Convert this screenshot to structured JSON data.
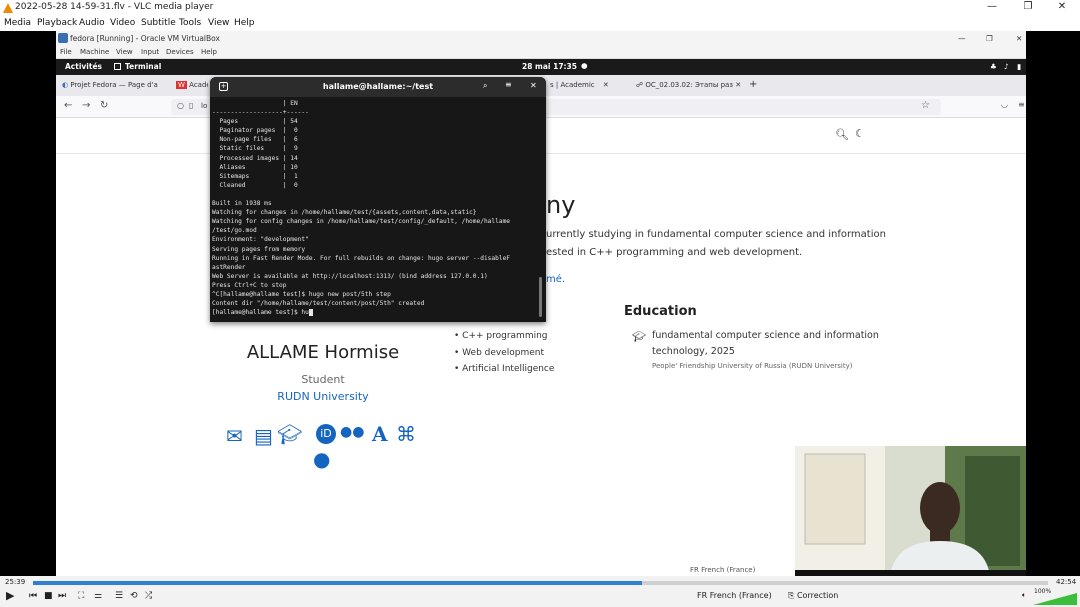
{
  "vlc": {
    "title": "2022-05-28 14-59-31.flv - VLC media player",
    "menu": [
      "Media",
      "Playback",
      "Audio",
      "Video",
      "Subtitle",
      "Tools",
      "View",
      "Help"
    ],
    "time_elapsed": "25:39",
    "time_total": "42:54",
    "progress": 0.6,
    "volume": "100%"
  },
  "vbox": {
    "title": "fedora [Running] - Oracle VM VirtualBox",
    "menu": [
      "File",
      "Machine",
      "View",
      "Input",
      "Devices",
      "Help"
    ]
  },
  "gnome": {
    "activities": "Activités",
    "app": "Terminal",
    "clock": "28 mai 17:35"
  },
  "firefox": {
    "tabs": [
      "Projet Fedora — Page d'a",
      "Acade",
      "s | Academic",
      "OC_02.03.02: Этапы раз"
    ],
    "url": "lo"
  },
  "site": {
    "heading_fragment": "ny",
    "bio_line1": "urrently studying in fundamental computer science and information",
    "bio_line2": "ested in C++ programming and web development.",
    "resume_link": "mé.",
    "name": "ALLAME Hormise",
    "role": "Student",
    "org": "RUDN University",
    "interests": [
      "C++ programming",
      "Web development",
      "Artificial Intelligence"
    ],
    "education_title": "Education",
    "edu_degree_1": "fundamental computer science and information",
    "edu_degree_2": "technology, 2025",
    "edu_school": "People' Friendship University of Russia (RUDN University)"
  },
  "terminal": {
    "title": "hallame@hallame:~/test",
    "lines": [
      "                   | EN",
      "-------------------+------",
      "  Pages            | 54",
      "  Paginator pages  |  0",
      "  Non-page files   |  6",
      "  Static files     |  9",
      "  Processed images | 14",
      "  Aliases          | 10",
      "  Sitemaps         |  1",
      "  Cleaned          |  0",
      "",
      "Built in 1938 ms",
      "Watching for changes in /home/hallame/test/{assets,content,data,static}",
      "Watching for config changes in /home/hallame/test/config/_default, /home/hallame",
      "/test/go.mod",
      "Environment: \"development\"",
      "Serving pages from memory",
      "Running in Fast Render Mode. For full rebuilds on change: hugo server --disableF",
      "astRender",
      "Web Server is available at http://localhost:1313/ (bind address 127.0.0.1)",
      "Press Ctrl+C to stop",
      "^C[hallame@hallame test]$ hugo new post/5th step",
      "Content dir \"/home/hallame/test/content/post/5th\" created",
      "[hallame@hallame test]$ hu"
    ]
  },
  "taskbar": {
    "lang": "FR French (France)",
    "correction": "Correction"
  }
}
